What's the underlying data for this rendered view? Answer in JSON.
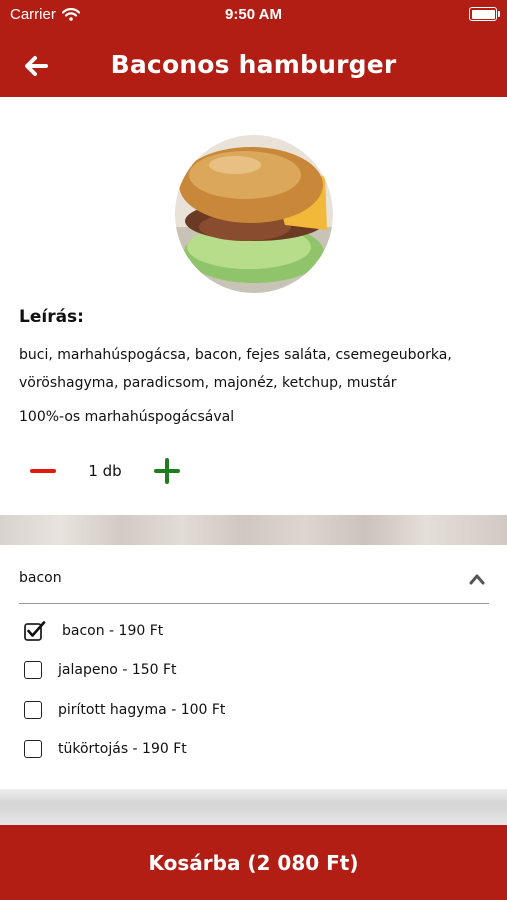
{
  "status": {
    "carrier": "Carrier",
    "time": "9:50 AM"
  },
  "header": {
    "title": "Baconos hamburger"
  },
  "product": {
    "description_label": "Leírás:",
    "description_line1": "buci, marhahúspogácsa, bacon, fejes saláta, csemegeuborka,",
    "description_line2": "vöröshagyma, paradicsom, majonéz, ketchup, mustár",
    "note": "100%-os marhahúspogácsával",
    "quantity": "1 db"
  },
  "extras": {
    "title": "bacon",
    "options": [
      {
        "label": "bacon - 190 Ft",
        "checked": true
      },
      {
        "label": "jalapeno - 150 Ft",
        "checked": false
      },
      {
        "label": "pirított hagyma - 100 Ft",
        "checked": false
      },
      {
        "label": "tükörtojás - 190 Ft",
        "checked": false
      }
    ]
  },
  "cart": {
    "label": "Kosárba (2 080 Ft)"
  },
  "colors": {
    "brand": "#b31e14",
    "minus": "#e1190f",
    "plus": "#1e7d1e"
  },
  "icons": [
    "wifi-icon",
    "battery-icon",
    "back-arrow-icon",
    "minus-icon",
    "plus-icon",
    "chevron-up-icon",
    "checkbox-checked-icon",
    "checkbox-icon"
  ]
}
